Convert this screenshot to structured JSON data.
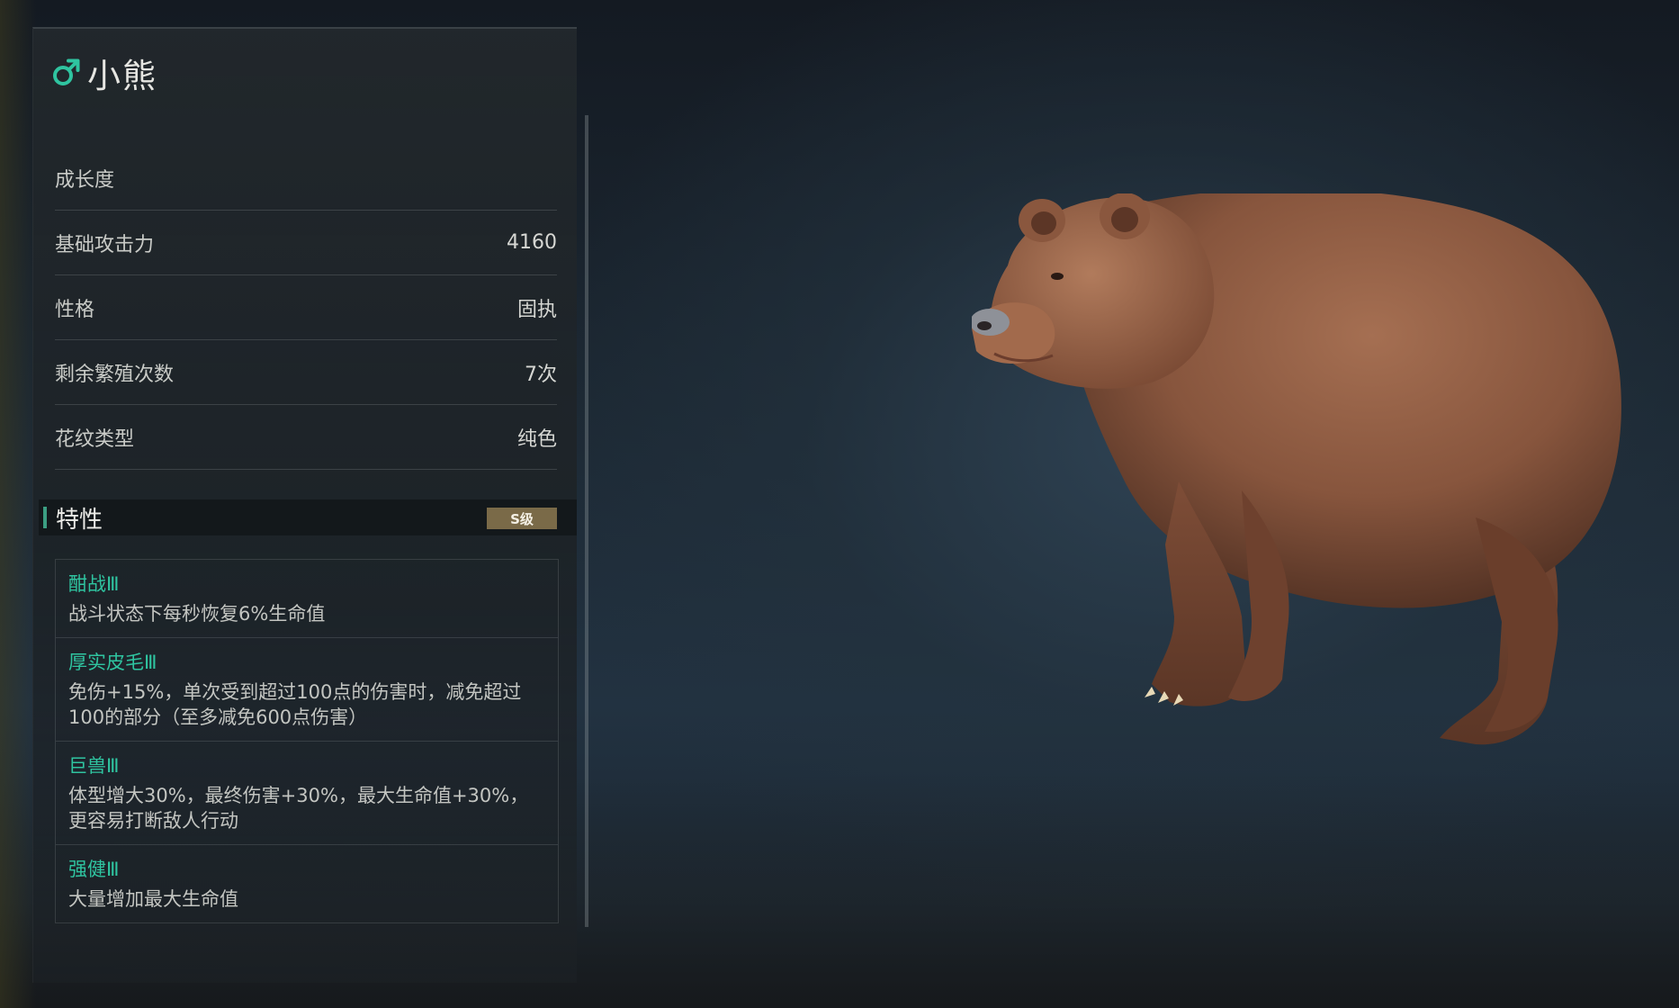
{
  "pet": {
    "name": "小熊",
    "gender_icon": "male-icon",
    "gender_color": "#2fc4a0"
  },
  "stats": [
    {
      "label": "成长度",
      "value": ""
    },
    {
      "label": "基础攻击力",
      "value": "4160"
    },
    {
      "label": "性格",
      "value": "固执"
    },
    {
      "label": "剩余繁殖次数",
      "value": "7次"
    },
    {
      "label": "花纹类型",
      "value": "纯色"
    }
  ],
  "traits": {
    "title": "特性",
    "grade": "S级",
    "items": [
      {
        "name": "酣战Ⅲ",
        "desc": "战斗状态下每秒恢复6%生命值"
      },
      {
        "name": "厚实皮毛Ⅲ",
        "desc": "免伤+15%，单次受到超过100点的伤害时，减免超过100的部分（至多减免600点伤害）"
      },
      {
        "name": "巨兽Ⅲ",
        "desc": "体型增大30%，最终伤害+30%，最大生命值+30%，更容易打断敌人行动"
      },
      {
        "name": "强健Ⅲ",
        "desc": "大量增加最大生命值"
      }
    ]
  },
  "colors": {
    "accent": "#2fc4a0",
    "grade_badge": "#7a6a48"
  }
}
